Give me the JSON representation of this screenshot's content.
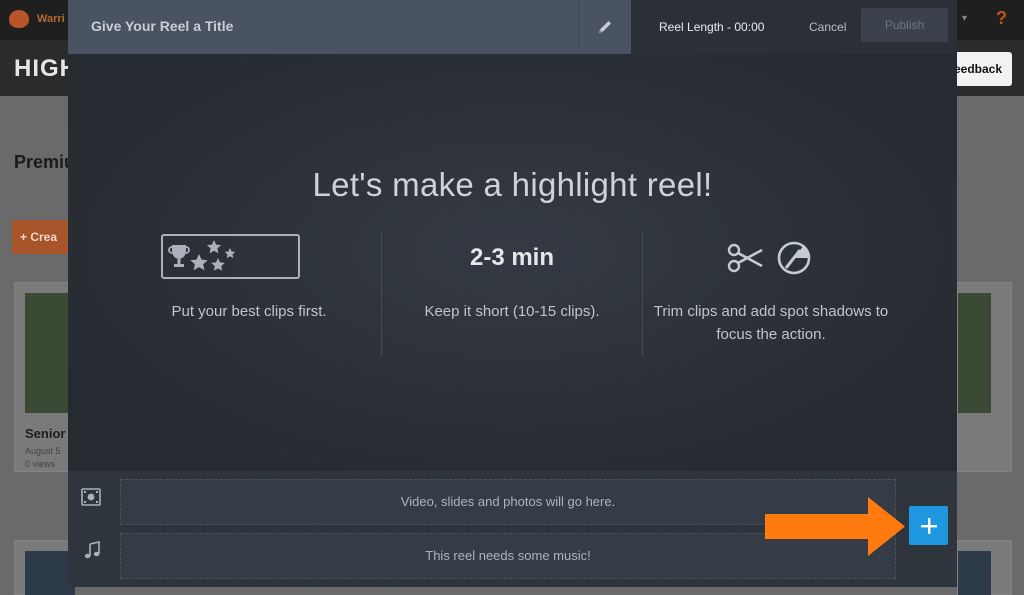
{
  "background": {
    "brand": "Warri",
    "header_title": "HIGH",
    "feedback_label": "eedback",
    "help_glyph": "?",
    "section_title": "Premiu",
    "create_label": "+ Crea",
    "card": {
      "title": "Senior",
      "date": "August 5",
      "views": "0 views"
    }
  },
  "modal": {
    "title_placeholder": "Give Your Reel a Title",
    "reel_length": "Reel Length - 00:00",
    "cancel_label": "Cancel",
    "publish_label": "Publish",
    "headline": "Let's make a highlight reel!",
    "tips": [
      {
        "icon": "trophy-stars-icon",
        "text": "Put your best clips first."
      },
      {
        "stat": "2-3 min",
        "text": "Keep it short (10-15 clips)."
      },
      {
        "icon": "scissors-spotlight-icon",
        "text": "Trim clips and add spot shadows to focus the action."
      }
    ],
    "video_track_placeholder": "Video, slides and photos will go here.",
    "music_track_placeholder": "This reel needs some music!"
  },
  "colors": {
    "accent_blue": "#1f97e0",
    "arrow_orange": "#ff7a0f",
    "modal_bg": "#2a2f36",
    "title_bar": "#4a5361"
  }
}
